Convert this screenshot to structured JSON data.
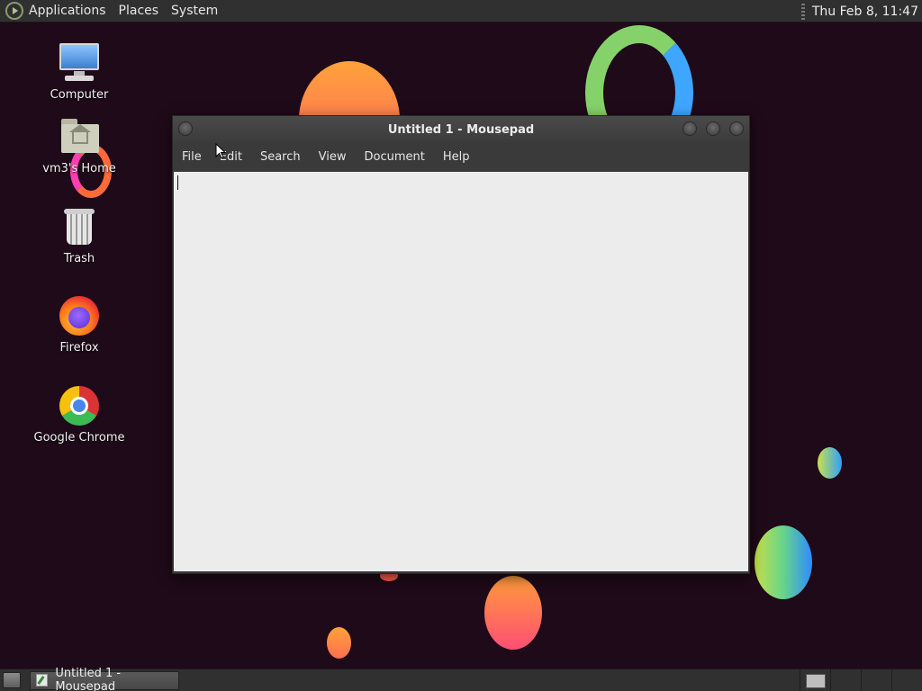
{
  "top_panel": {
    "menus": [
      "Applications",
      "Places",
      "System"
    ],
    "clock": "Thu Feb  8, 11:47"
  },
  "desktop": {
    "icons": [
      {
        "label": "Computer",
        "icon": "computer-icon"
      },
      {
        "label": "vm3's Home",
        "icon": "home-folder-icon"
      },
      {
        "label": "Trash",
        "icon": "trash-icon"
      },
      {
        "label": "Firefox",
        "icon": "firefox-icon"
      },
      {
        "label": "Google Chrome",
        "icon": "chrome-icon"
      }
    ]
  },
  "window": {
    "title": "Untitled 1 - Mousepad",
    "menus": [
      "File",
      "Edit",
      "Search",
      "View",
      "Document",
      "Help"
    ],
    "content": ""
  },
  "taskbar": {
    "tasks": [
      {
        "label": "Untitled 1 - Mousepad",
        "icon": "mousepad-icon"
      }
    ]
  },
  "colors": {
    "wallpaper": "#1f0a19",
    "panel": "#303030",
    "editor_bg": "#ececec"
  }
}
